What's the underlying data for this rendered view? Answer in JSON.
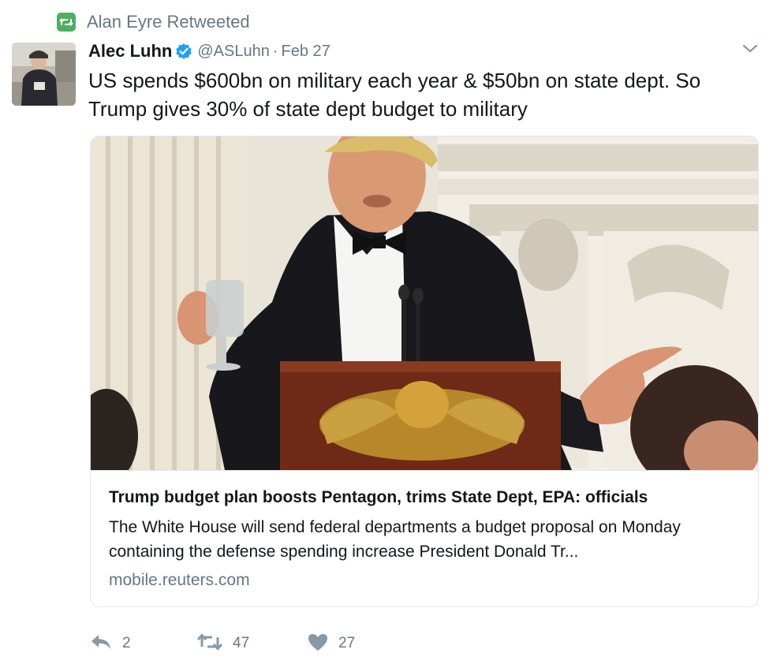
{
  "retweet_context": {
    "text": "Alan Eyre Retweeted",
    "icon": "retweet-icon",
    "badge_color": "#4cb060"
  },
  "author": {
    "display_name": "Alec Luhn",
    "verified": true,
    "handle": "@ASLuhn",
    "separator": "·",
    "date": "Feb 27"
  },
  "tweet": {
    "text": "US spends $600bn on military each year & $50bn on state dept. So Trump gives 30% of state dept budget to military"
  },
  "card": {
    "title": "Trump budget plan boosts Pentagon, trims State Dept, EPA: officials",
    "description": "The White House will send federal departments a budget proposal on Monday containing the defense spending increase President Donald Tr...",
    "domain": "mobile.reuters.com"
  },
  "actions": {
    "reply_count": "2",
    "retweet_count": "47",
    "like_count": "27"
  },
  "colors": {
    "text": "#14171a",
    "secondary": "#657786",
    "verified": "#1da1f2",
    "border": "#e1e8ed"
  }
}
